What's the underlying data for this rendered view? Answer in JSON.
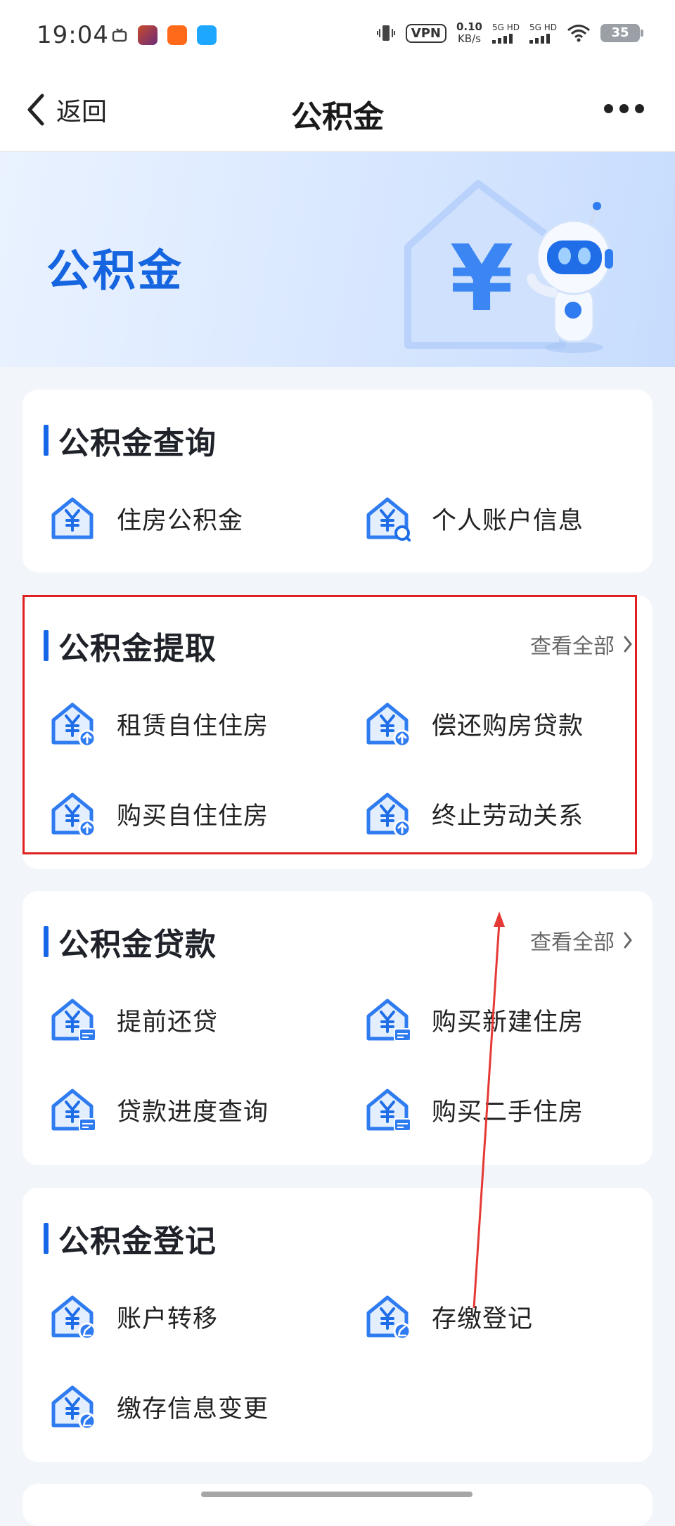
{
  "status_bar": {
    "time": "19:04",
    "vpn": "VPN",
    "speed_value": "0.10",
    "speed_unit": "KB/s",
    "signal_1": "5G HD",
    "signal_2": "5G HD",
    "battery": "35"
  },
  "nav": {
    "back_label": "返回",
    "title": "公积金"
  },
  "banner": {
    "title": "公积金",
    "currency_symbol": "¥"
  },
  "sections": {
    "query": {
      "title": "公积金查询",
      "items": [
        "住房公积金",
        "个人账户信息"
      ]
    },
    "withdraw": {
      "title": "公积金提取",
      "view_all": "查看全部",
      "items": [
        "租赁自住住房",
        "偿还购房贷款",
        "购买自住住房",
        "终止劳动关系"
      ]
    },
    "loan": {
      "title": "公积金贷款",
      "view_all": "查看全部",
      "items": [
        "提前还贷",
        "购买新建住房",
        "贷款进度查询",
        "购买二手住房"
      ]
    },
    "register": {
      "title": "公积金登记",
      "items": [
        "账户转移",
        "存缴登记",
        "缴存信息变更"
      ]
    }
  },
  "colors": {
    "brand_blue": "#1567e8",
    "highlight_red": "#e02020",
    "arrow_red": "#e53935"
  },
  "icons": {
    "house_yuan": "house-yuan-icon",
    "search_badge": "search-badge-icon",
    "upload_badge": "upload-badge-icon",
    "card_badge": "card-badge-icon",
    "edit_badge": "edit-badge-icon"
  }
}
